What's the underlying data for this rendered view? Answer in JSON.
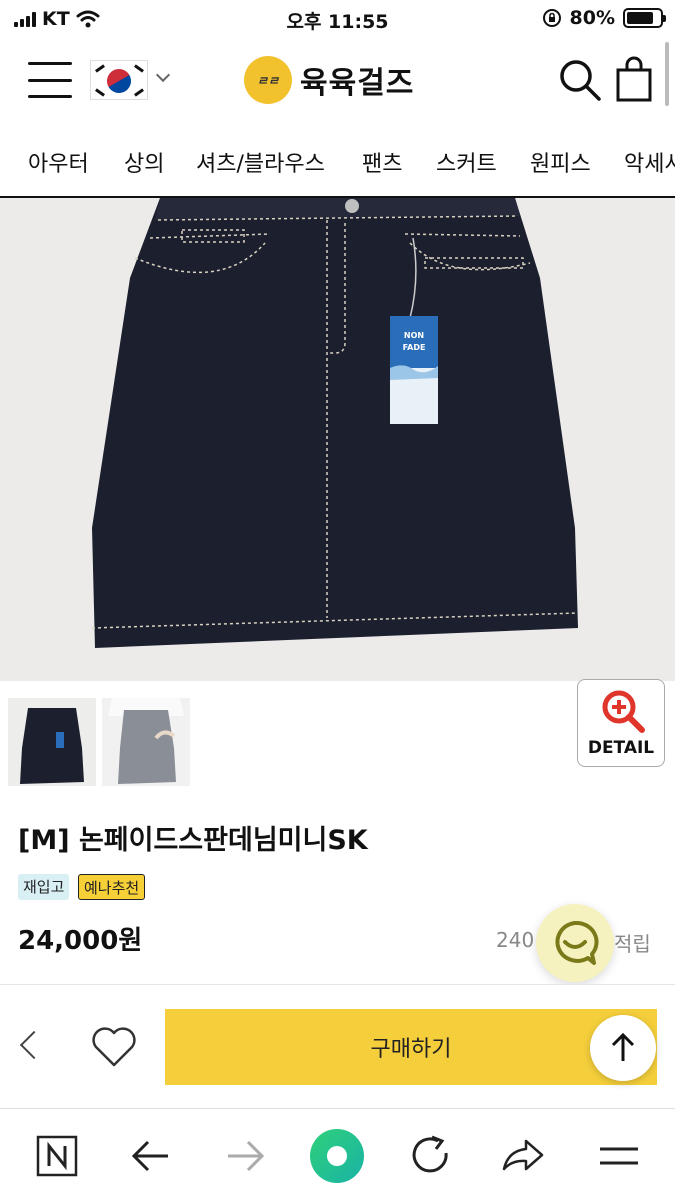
{
  "status_bar": {
    "carrier": "KT",
    "time": "오후 11:55",
    "battery": "80%",
    "battery_level": 0.8
  },
  "header": {
    "logo_mark": "ㄹㄹ",
    "logo_text": "육육걸즈",
    "icons": [
      "hamburger-icon",
      "korea-flag-icon",
      "chevron-down-icon",
      "search-icon",
      "shopping-bag-icon"
    ]
  },
  "categories": [
    "아우터",
    "상의",
    "셔츠/블라우스",
    "팬츠",
    "스커트",
    "원피스",
    "악세사"
  ],
  "product": {
    "tag_line1": "NON",
    "tag_line2": "FADE",
    "detail_label": "DETAIL",
    "title": "[M] 논페이드스판데님미니SK",
    "badges": [
      "재입고",
      "예나추천"
    ],
    "price": "24,000원",
    "points_prefix": "240",
    "points_suffix": "적립"
  },
  "buy_bar": {
    "buy_label": "구매하기"
  },
  "colors": {
    "accent_yellow": "#f5cf3b",
    "denim": "#1c1f2e",
    "badge_blue": "#d8f0f4"
  }
}
